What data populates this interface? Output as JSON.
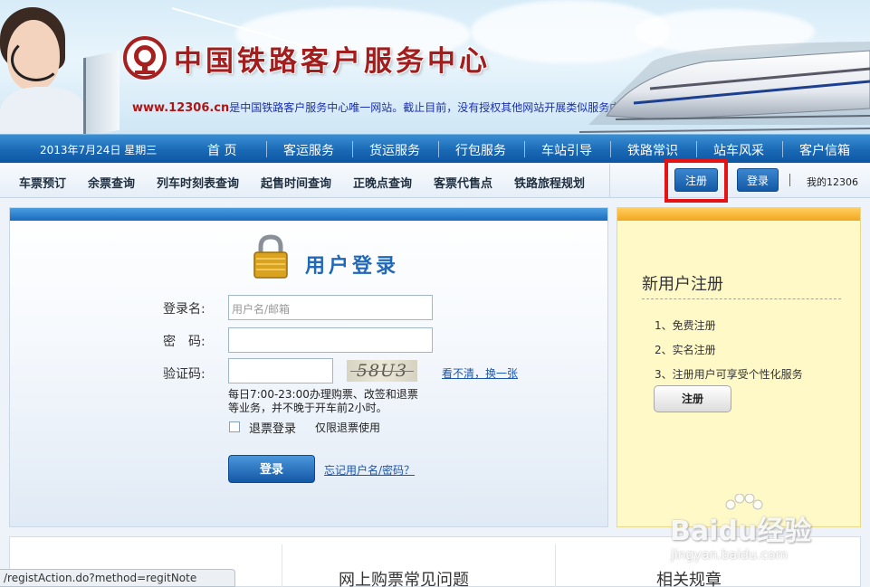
{
  "header": {
    "site_title": "中国铁路客户服务中心",
    "tagline_url": "www.12306.cn",
    "tagline_text": "是中国铁路客户服务中心唯一网站。截止目前，没有授权其他网站开展类似服务内容，敬..."
  },
  "main_nav": {
    "date": "2013年7月24日 星期三",
    "items": [
      "首 页",
      "客运服务",
      "货运服务",
      "行包服务",
      "车站引导",
      "铁路常识",
      "站车风采",
      "客户信箱"
    ]
  },
  "sub_nav": {
    "items": [
      "车票预订",
      "余票查询",
      "列车时刻表查询",
      "起售时间查询",
      "正晚点查询",
      "客票代售点",
      "铁路旅程规划"
    ],
    "register_label": "注册",
    "login_label": "登录",
    "my_label": "我的12306"
  },
  "login": {
    "heading": "用户登录",
    "username_label": "登录名:",
    "username_placeholder": "用户名/邮箱",
    "password_label": "密　码:",
    "captcha_label": "验证码:",
    "captcha_text": "58U3",
    "refresh_captcha": "看不清，换一张",
    "notice": "每日7:00-23:00办理购票、改签和退票等业务，并不晚于开车前2小时。",
    "refund_login_label": "退票登录",
    "refund_only_note": "仅限退票使用",
    "login_button": "登录",
    "forgot_link": "忘记用户名/密码？"
  },
  "register": {
    "title": "新用户注册",
    "items": [
      "1、免费注册",
      "2、实名注册",
      "3、注册用户可享受个性化服务"
    ],
    "button": "注册"
  },
  "bottom": {
    "faq_title": "网上购票常见问题",
    "rules_title": "相关规章"
  },
  "status_bar": {
    "url": "/registAction.do?method=regitNote"
  },
  "watermark": {
    "brand": "Baidu经验",
    "url": "jingyan.baidu.com"
  },
  "colors": {
    "nav_blue": "#1a69b6",
    "title_red": "#a21d1d",
    "highlight_red": "#e51313",
    "register_bg": "#fff9c7"
  }
}
